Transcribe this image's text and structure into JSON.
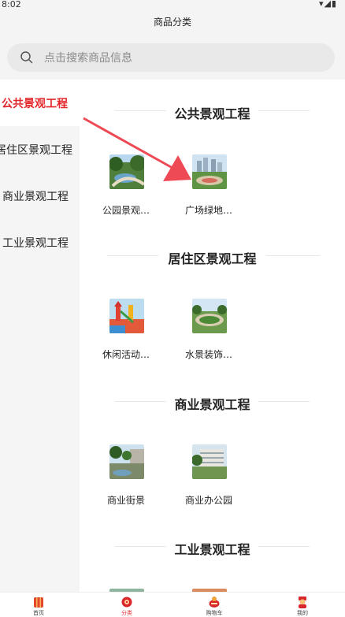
{
  "status_bar": {
    "time": "8:02",
    "icons": "▾◢▮"
  },
  "header": {
    "title": "商品分类"
  },
  "search": {
    "placeholder": "点击搜索商品信息"
  },
  "sidebar": {
    "items": [
      {
        "label": "公共景观工程",
        "active": true
      },
      {
        "label": "居住区景观工程",
        "active": false
      },
      {
        "label": "商业景观工程",
        "active": false
      },
      {
        "label": "工业景观工程",
        "active": false
      }
    ]
  },
  "sections": [
    {
      "title": "公共景观工程",
      "products": [
        {
          "name": "公园景观…"
        },
        {
          "name": "广场绿地…"
        }
      ]
    },
    {
      "title": "居住区景观工程",
      "products": [
        {
          "name": "休闲活动…"
        },
        {
          "name": "水景装饰…"
        }
      ]
    },
    {
      "title": "商业景观工程",
      "products": [
        {
          "name": "商业街景"
        },
        {
          "name": "商业办公园"
        }
      ]
    },
    {
      "title": "工业景观工程",
      "products": []
    }
  ],
  "tabbar": {
    "tabs": [
      {
        "label": "首页",
        "active": false
      },
      {
        "label": "分类",
        "active": true
      },
      {
        "label": "购物车",
        "active": false
      },
      {
        "label": "我的",
        "active": false
      }
    ]
  },
  "colors": {
    "accent": "#e3282d",
    "background": "#f4f4f4"
  }
}
